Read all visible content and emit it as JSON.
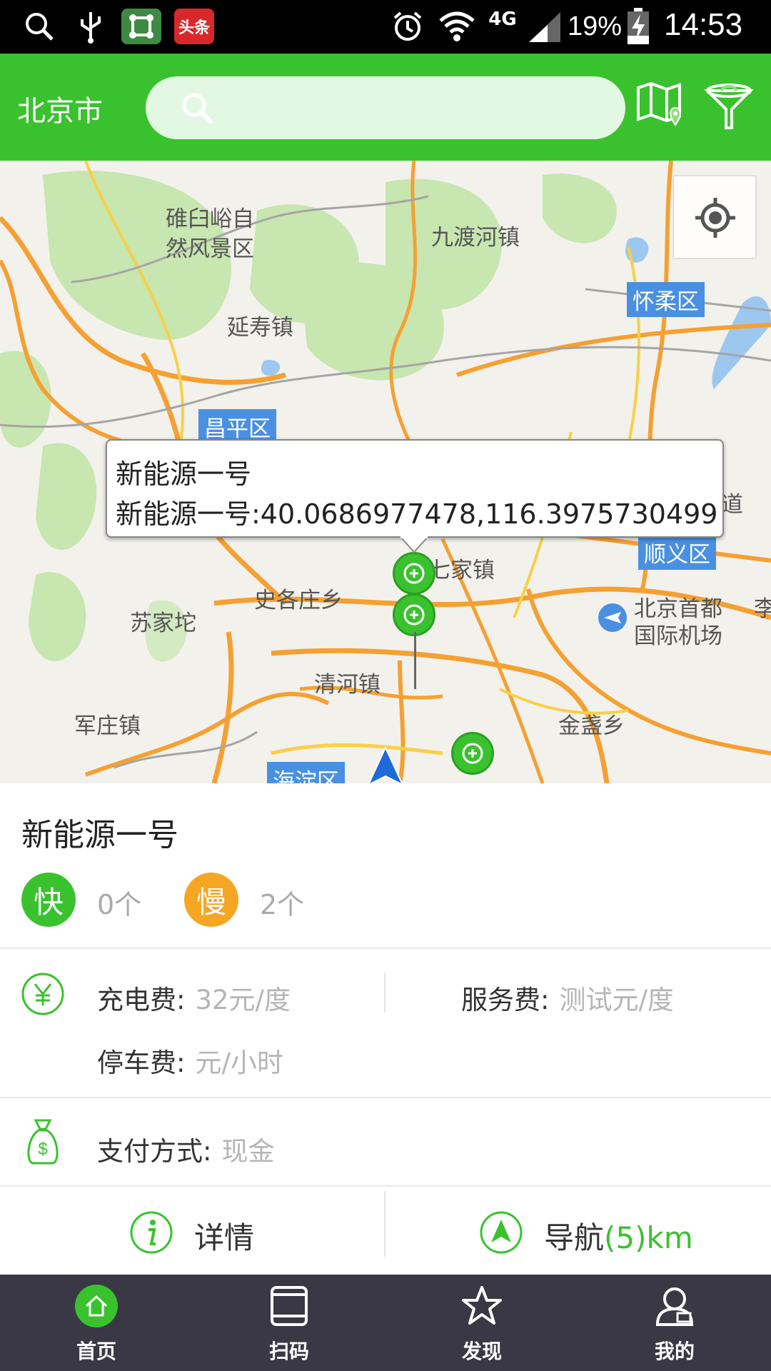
{
  "status_bar": {
    "battery": "19%",
    "time": "14:53",
    "network": "4G",
    "notification_app": "头条"
  },
  "header": {
    "city": "北京市",
    "search_placeholder": ""
  },
  "map": {
    "labels": {
      "l1": "碓臼峪自",
      "l2": "然风景区",
      "l3": "九渡河镇",
      "l4": "延寿镇",
      "l5": "史各庄乡",
      "l6": "苏家坨",
      "l7": "清河镇",
      "l8": "军庄镇",
      "l9": "金盏乡",
      "l10": "北京首都",
      "l11": "国际机场",
      "l12": "道",
      "l13": "李",
      "l14": "七家镇"
    },
    "districts": {
      "d1": "怀柔区",
      "d2": "昌平区",
      "d3": "顺义区",
      "d4": "海淀区"
    },
    "callout": {
      "title": "新能源一号",
      "coords": "新能源一号:40.0686977478,116.3975730499"
    }
  },
  "station": {
    "name": "新能源一号",
    "fast_label": "快",
    "fast_count": "0个",
    "slow_label": "慢",
    "slow_count": "2个",
    "charge_fee_label": "充电费:",
    "charge_fee_value": "32元/度",
    "service_fee_label": "服务费:",
    "service_fee_value": "测试元/度",
    "parking_fee_label": "停车费:",
    "parking_fee_value": "元/小时",
    "payment_label": "支付方式:",
    "payment_value": "现金",
    "details_label": "详情",
    "navigate_label": "导航",
    "navigate_distance": "(5)km"
  },
  "bottom_nav": {
    "home": "首页",
    "scan": "扫码",
    "discover": "发现",
    "mine": "我的"
  },
  "colors": {
    "brand_green": "#39c22e",
    "slow_orange": "#f5a623",
    "nav_bg": "#3a3844",
    "district_blue": "#4a90e2"
  }
}
